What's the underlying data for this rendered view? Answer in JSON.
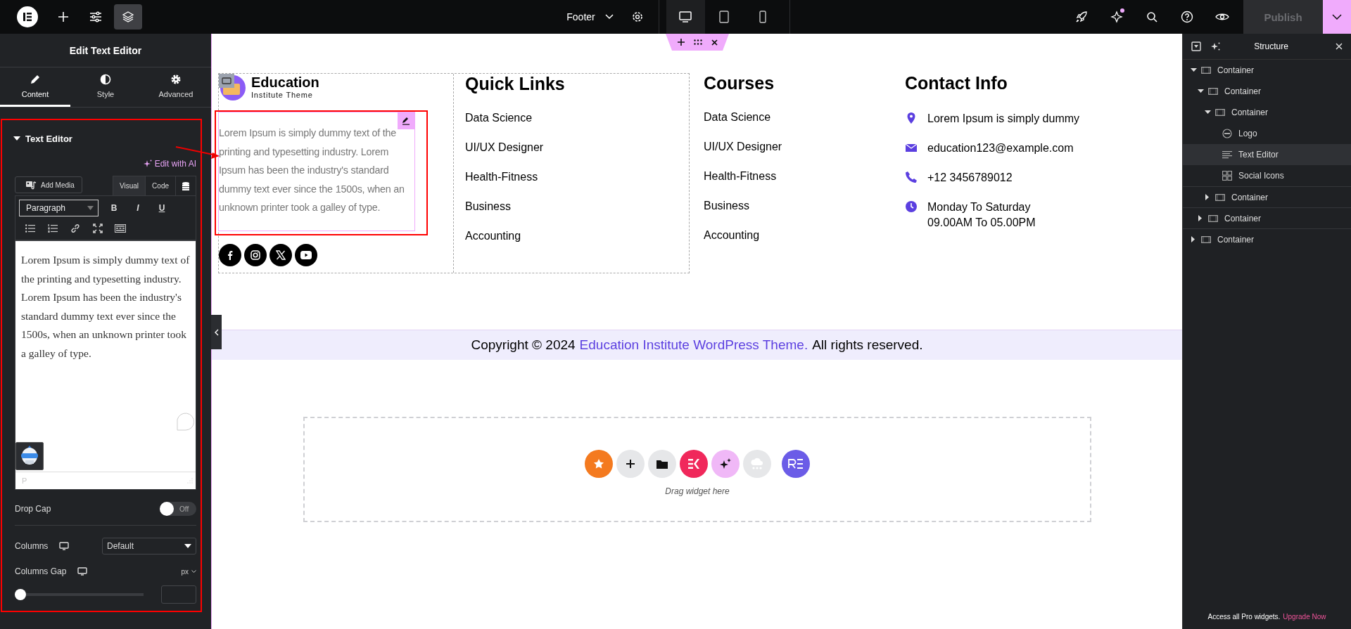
{
  "topbar": {
    "page": "Footer",
    "devices": [
      {
        "kind": "desktop",
        "selected": true
      },
      {
        "kind": "tablet",
        "selected": false
      },
      {
        "kind": "mobile",
        "selected": false
      }
    ],
    "publish": {
      "label": "Publish",
      "disabled": true
    }
  },
  "left_panel": {
    "title": "Edit Text Editor",
    "tabs": [
      {
        "label": "Content",
        "kind": "pencil",
        "selected": true
      },
      {
        "label": "Style",
        "kind": "contrast",
        "selected": false
      },
      {
        "label": "Advanced",
        "kind": "gear",
        "selected": false
      }
    ],
    "section": {
      "title": "Text Editor",
      "expanded": true
    },
    "ai_link": "Edit with AI",
    "add_media": "Add Media",
    "editor_modes": [
      {
        "label": "Visual",
        "selected": true
      },
      {
        "label": "Code",
        "selected": false
      }
    ],
    "format": "Paragraph",
    "format_buttons": [
      {
        "label": "B",
        "kind": "bold"
      },
      {
        "label": "I",
        "kind": "italic"
      },
      {
        "label": "U",
        "kind": "underline"
      }
    ],
    "content": "Lorem Ipsum is simply dummy text of the printing and typesetting industry. Lorem Ipsum has been the industry's standard dummy text ever since the 1500s, when an unknown printer took a galley of type.",
    "element_path": "P",
    "drop_cap": {
      "label": "Drop Cap",
      "on": false,
      "state": "Off"
    },
    "columns": {
      "label": "Columns",
      "value": "Default"
    },
    "columns_gap": {
      "label": "Columns Gap",
      "unit": "px",
      "level": 0
    }
  },
  "canvas": {
    "logo": {
      "name": "Education",
      "tagline": "Institute Theme"
    },
    "about": "Lorem Ipsum is simply dummy text of the printing and typesetting industry. Lorem Ipsum has been the industry's standard dummy text ever since the 1500s, when an unknown printer took a galley of type.",
    "socials": [
      {
        "kind": "facebook"
      },
      {
        "kind": "instagram"
      },
      {
        "kind": "x"
      },
      {
        "kind": "youtube"
      }
    ],
    "link_columns": [
      {
        "title": "Quick Links",
        "links": [
          "Data Science",
          "UI/UX Designer",
          "Health-Fitness",
          "Business",
          "Accounting"
        ]
      },
      {
        "title": "Courses",
        "links": [
          "Data Science",
          "UI/UX Designer",
          "Health-Fitness",
          "Business",
          "Accounting"
        ]
      }
    ],
    "contact": {
      "title": "Contact Info",
      "items": [
        {
          "kind": "location",
          "lines": [
            "Lorem Ipsum is simply dummy"
          ]
        },
        {
          "kind": "email",
          "lines": [
            "education123@example.com"
          ]
        },
        {
          "kind": "phone",
          "lines": [
            "+12 3456789012"
          ]
        },
        {
          "kind": "clock",
          "lines": [
            "Monday To Saturday",
            "09.00AM To 05.00PM"
          ]
        }
      ]
    },
    "copyright": {
      "before": "Copyright © 2024",
      "link": "Education Institute WordPress Theme.",
      "after": "All rights reserved."
    },
    "dropzone": {
      "buttons": [
        {
          "kind": "star"
        },
        {
          "kind": "plus"
        },
        {
          "kind": "folder"
        },
        {
          "kind": "kit"
        },
        {
          "kind": "sparkle"
        },
        {
          "kind": "cloud"
        },
        {
          "kind": "re"
        }
      ],
      "hint": "Drag widget here"
    }
  },
  "structure": {
    "title": "Structure",
    "items": [
      {
        "label": "Container",
        "kind": "container",
        "selected": false,
        "expanded": true,
        "children": [
          {
            "label": "Container",
            "kind": "container",
            "selected": false,
            "expanded": true,
            "children": [
              {
                "label": "Container",
                "kind": "container",
                "selected": false,
                "expanded": true,
                "children": [
                  {
                    "label": "Logo",
                    "kind": "logo",
                    "selected": false
                  },
                  {
                    "label": "Text Editor",
                    "kind": "text",
                    "selected": true
                  },
                  {
                    "label": "Social Icons",
                    "kind": "social",
                    "selected": false
                  }
                ]
              },
              {
                "label": "Container",
                "kind": "container",
                "selected": false,
                "expanded": false
              }
            ]
          },
          {
            "label": "Container",
            "kind": "container",
            "selected": false,
            "expanded": false
          }
        ]
      },
      {
        "label": "Container",
        "kind": "container",
        "selected": false,
        "expanded": false
      }
    ],
    "promo": {
      "text": "Access all Pro widgets.",
      "link": "Upgrade Now"
    }
  }
}
